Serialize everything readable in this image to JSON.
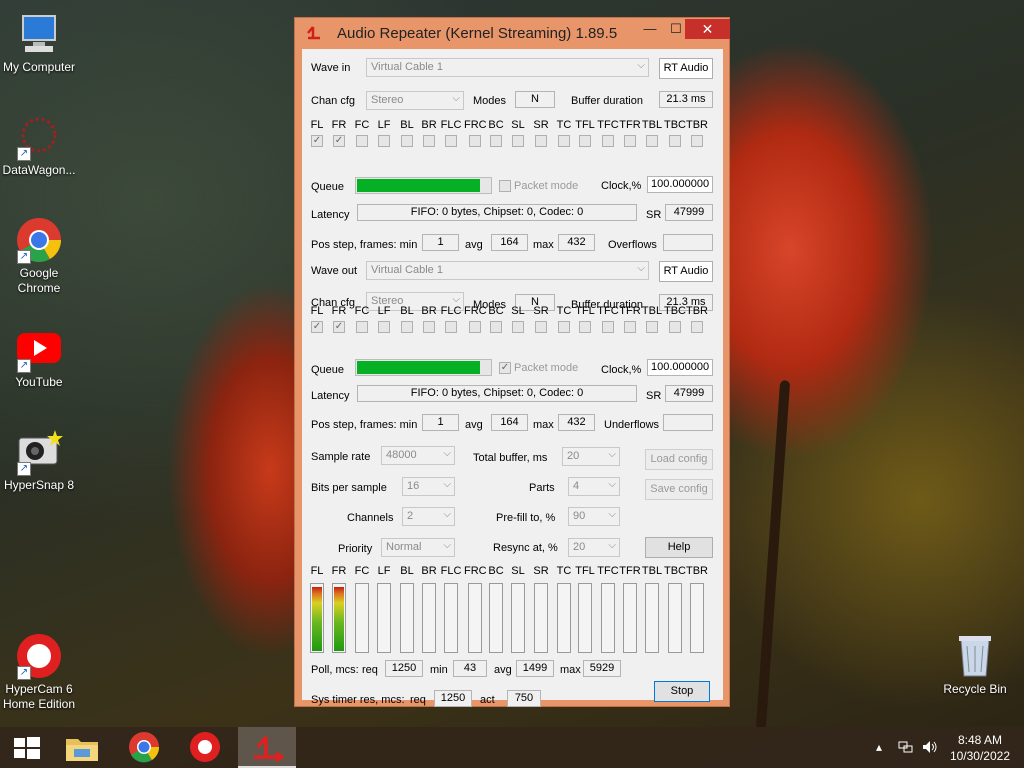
{
  "desktop": {
    "icons": [
      {
        "label": "My Computer"
      },
      {
        "label": "DataWagon..."
      },
      {
        "label": "Google Chrome"
      },
      {
        "label": "YouTube"
      },
      {
        "label": "HyperSnap 8"
      },
      {
        "label": "HyperCam 6 Home Edition"
      },
      {
        "label": "Recycle Bin"
      }
    ]
  },
  "window": {
    "title": "Audio Repeater (Kernel Streaming) 1.89.5",
    "minimize": "—",
    "maximize": "☐",
    "close": "✕"
  },
  "channels": [
    "FL",
    "FR",
    "FC",
    "LF",
    "BL",
    "BR",
    "FLC",
    "FRC",
    "BC",
    "SL",
    "SR",
    "TC",
    "TFL",
    "TFC",
    "TFR",
    "TBL",
    "TBC",
    "TBR"
  ],
  "wave_in": {
    "label": "Wave in",
    "device": "Virtual Cable 1",
    "rt_button": "RT Audio",
    "chan_cfg_label": "Chan cfg",
    "chan_cfg": "Stereo",
    "modes_label": "Modes",
    "modes": "N",
    "buffer_label": "Buffer duration",
    "buffer": "21.3 ms",
    "checked": [
      true,
      true,
      false,
      false,
      false,
      false,
      false,
      false,
      false,
      false,
      false,
      false,
      false,
      false,
      false,
      false,
      false,
      false
    ],
    "queue_label": "Queue",
    "queue_fill": 0.91,
    "packet_mode_label": "Packet mode",
    "packet_mode": false,
    "clock_label": "Clock,%",
    "clock": "100.000000",
    "latency_label": "Latency",
    "latency": "FIFO: 0 bytes, Chipset: 0, Codec: 0",
    "sr_label": "SR",
    "sr": "47999",
    "pos_label": "Pos step, frames:  min",
    "pos_min": "1",
    "avg_label": "avg",
    "pos_avg": "164",
    "max_label": "max",
    "pos_max": "432",
    "flow_label": "Overflows",
    "flow": ""
  },
  "wave_out": {
    "label": "Wave out",
    "device": "Virtual Cable 1",
    "rt_button": "RT Audio",
    "chan_cfg_label": "Chan cfg",
    "chan_cfg": "Stereo",
    "modes_label": "Modes",
    "modes": "N",
    "buffer_label": "Buffer duration",
    "buffer": "21.3 ms",
    "checked": [
      true,
      true,
      false,
      false,
      false,
      false,
      false,
      false,
      false,
      false,
      false,
      false,
      false,
      false,
      false,
      false,
      false,
      false
    ],
    "queue_label": "Queue",
    "queue_fill": 0.91,
    "packet_mode_label": "Packet mode",
    "packet_mode": true,
    "clock_label": "Clock,%",
    "clock": "100.000000",
    "latency_label": "Latency",
    "latency": "FIFO: 0 bytes, Chipset: 0, Codec: 0",
    "sr_label": "SR",
    "sr": "47999",
    "pos_label": "Pos step, frames:  min",
    "pos_min": "1",
    "avg_label": "avg",
    "pos_avg": "164",
    "max_label": "max",
    "pos_max": "432",
    "flow_label": "Underflows",
    "flow": ""
  },
  "settings": {
    "sample_rate_label": "Sample rate",
    "sample_rate": "48000",
    "total_buffer_label": "Total buffer, ms",
    "total_buffer": "20",
    "load_config": "Load config",
    "bits_label": "Bits per sample",
    "bits": "16",
    "parts_label": "Parts",
    "parts": "4",
    "save_config": "Save config",
    "channels_label": "Channels",
    "channels": "2",
    "prefill_label": "Pre-fill to, %",
    "prefill": "90",
    "priority_label": "Priority",
    "priority": "Normal",
    "resync_label": "Resync at, %",
    "resync": "20",
    "help": "Help"
  },
  "meters": {
    "levels": [
      0.97,
      0.97,
      0,
      0,
      0,
      0,
      0,
      0,
      0,
      0,
      0,
      0,
      0,
      0,
      0,
      0,
      0,
      0
    ]
  },
  "poll": {
    "label": "Poll, mcs:",
    "req_label": "req",
    "req": "1250",
    "min_label": "min",
    "min": "43",
    "avg_label": "avg",
    "avg": "1499",
    "max_label": "max",
    "max": "5929"
  },
  "timer": {
    "label": "Sys timer res, mcs:",
    "req_label": "req",
    "req": "1250",
    "act_label": "act",
    "act": "750",
    "stop": "Stop"
  },
  "taskbar": {
    "time": "8:48 AM",
    "date": "10/30/2022"
  }
}
